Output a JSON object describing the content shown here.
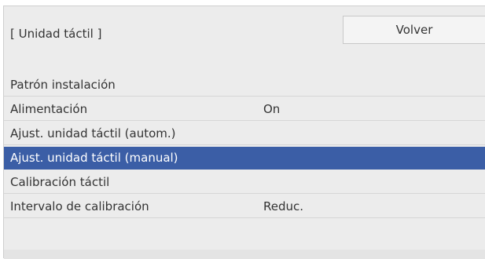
{
  "header": {
    "title": "[ Unidad táctil ]",
    "back_label": "Volver"
  },
  "menu": {
    "items": [
      {
        "label": "Patrón instalación",
        "value": ""
      },
      {
        "label": "Alimentación",
        "value": "On"
      },
      {
        "label": "Ajust. unidad táctil (autom.)",
        "value": ""
      },
      {
        "label": "Ajust. unidad táctil (manual)",
        "value": "",
        "selected": true
      },
      {
        "label": "Calibración táctil",
        "value": ""
      },
      {
        "label": "Intervalo de calibración",
        "value": "Reduc."
      }
    ]
  },
  "colors": {
    "selected_background": "#3b5ea6",
    "panel_background": "#ececec"
  }
}
